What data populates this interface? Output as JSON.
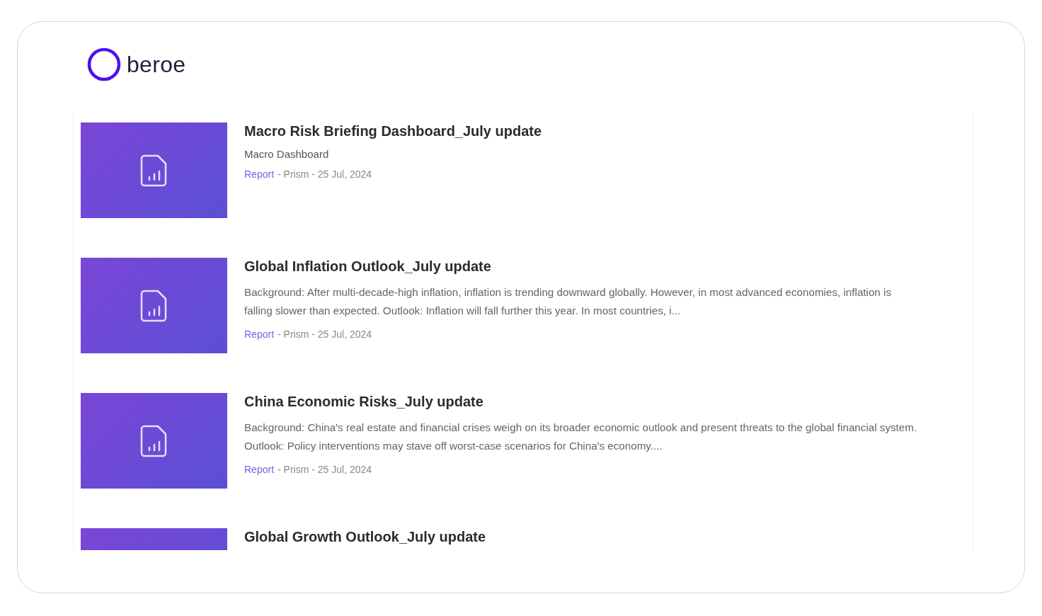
{
  "brand": {
    "name": "beroe"
  },
  "results": [
    {
      "title": "Macro Risk Briefing Dashboard_July update",
      "subtitle": "Macro Dashboard",
      "meta": {
        "type": "Report",
        "rest": "- Prism - 25 Jul, 2024"
      }
    },
    {
      "title": "Global Inflation Outlook_July update",
      "description": "Background: After multi-decade-high inflation, inflation is trending downward globally. However, in most advanced economies, inflation is falling slower than expected. Outlook: Inflation will fall further this year. In most countries, i...",
      "meta": {
        "type": "Report",
        "rest": "- Prism - 25 Jul, 2024"
      }
    },
    {
      "title": "China Economic Risks_July update",
      "description": "Background: China's real estate and financial crises weigh on its broader economic outlook and present threats to the global financial system. Outlook: Policy interventions may stave off worst-case scenarios for China's economy....",
      "meta": {
        "type": "Report",
        "rest": "- Prism - 25 Jul, 2024"
      }
    },
    {
      "title": "Global Growth Outlook_July update"
    }
  ]
}
